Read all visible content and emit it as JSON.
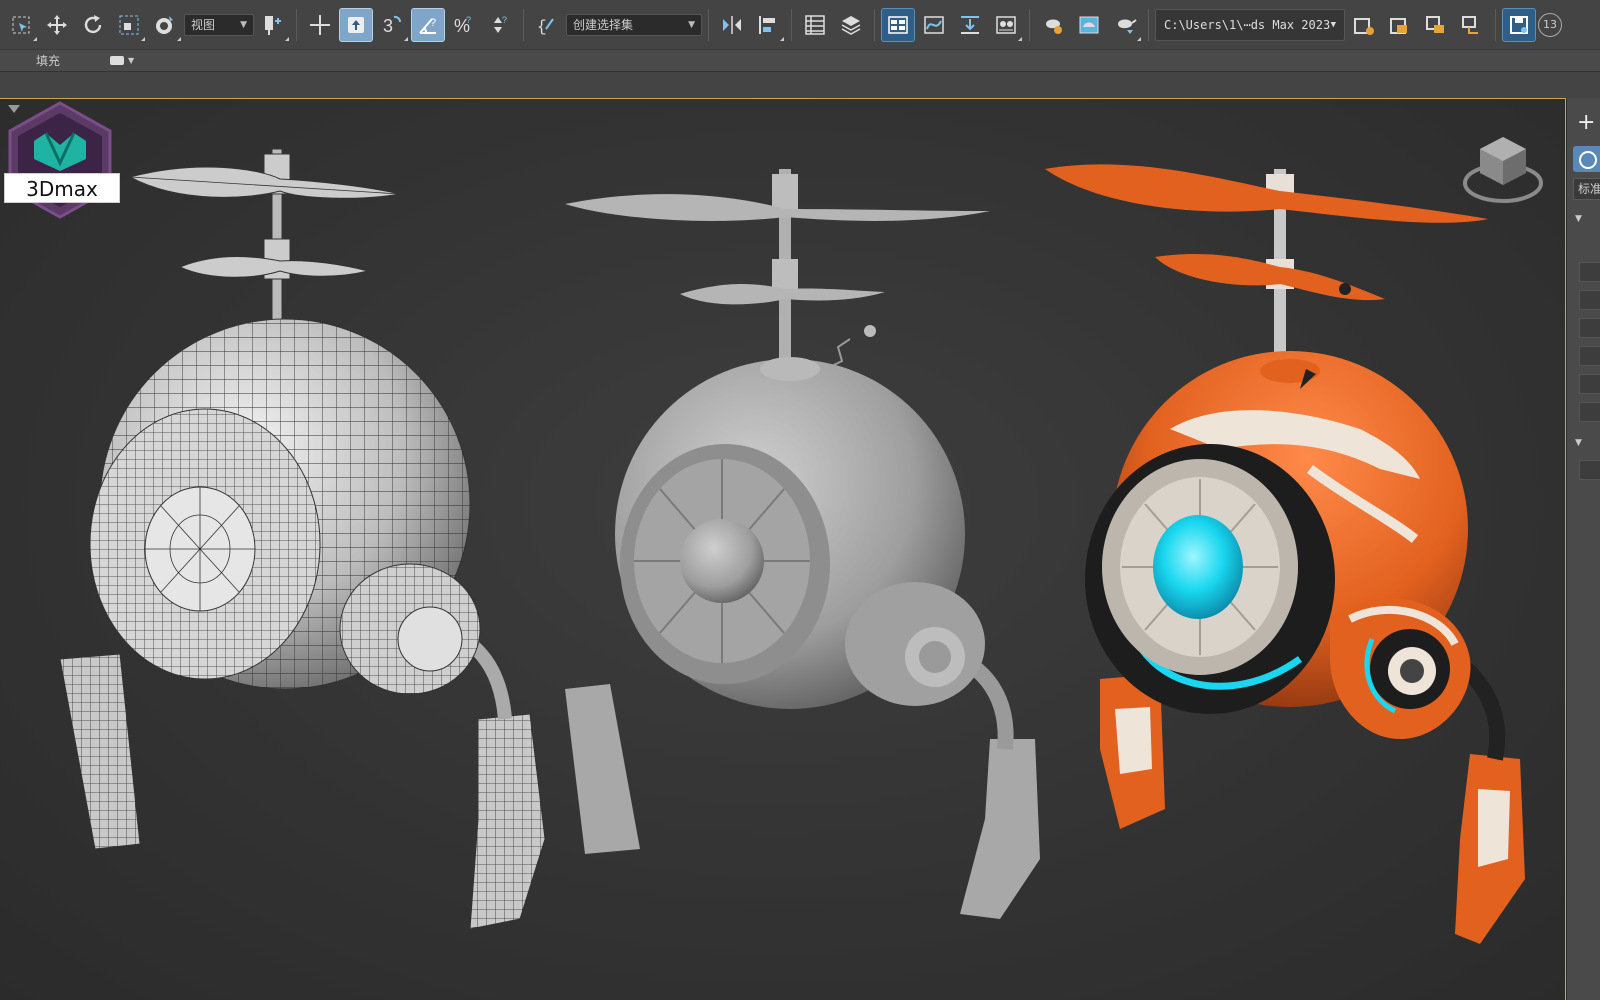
{
  "toolbar": {
    "view_dropdown": "视图",
    "selection_set_dropdown": "创建选择集",
    "angle_snap_label": "3",
    "project_path": "C:\\Users\\1\\⋯ds Max 2023",
    "viewport_count": "13"
  },
  "ribbon": {
    "fill_label": "填充"
  },
  "viewport": {
    "logo_text": "3Dmax",
    "models": [
      {
        "name": "wireframe-robot",
        "style": "wireframe"
      },
      {
        "name": "clay-robot",
        "style": "clay"
      },
      {
        "name": "textured-robot",
        "style": "textured"
      }
    ],
    "colors": {
      "border_active": "#c9a64a",
      "orange": "#e2611f",
      "cyan": "#19d7ef",
      "clay": "#a6a6a6"
    }
  },
  "command_panel": {
    "create_icon": "plus-icon",
    "standard_label": "标准"
  }
}
